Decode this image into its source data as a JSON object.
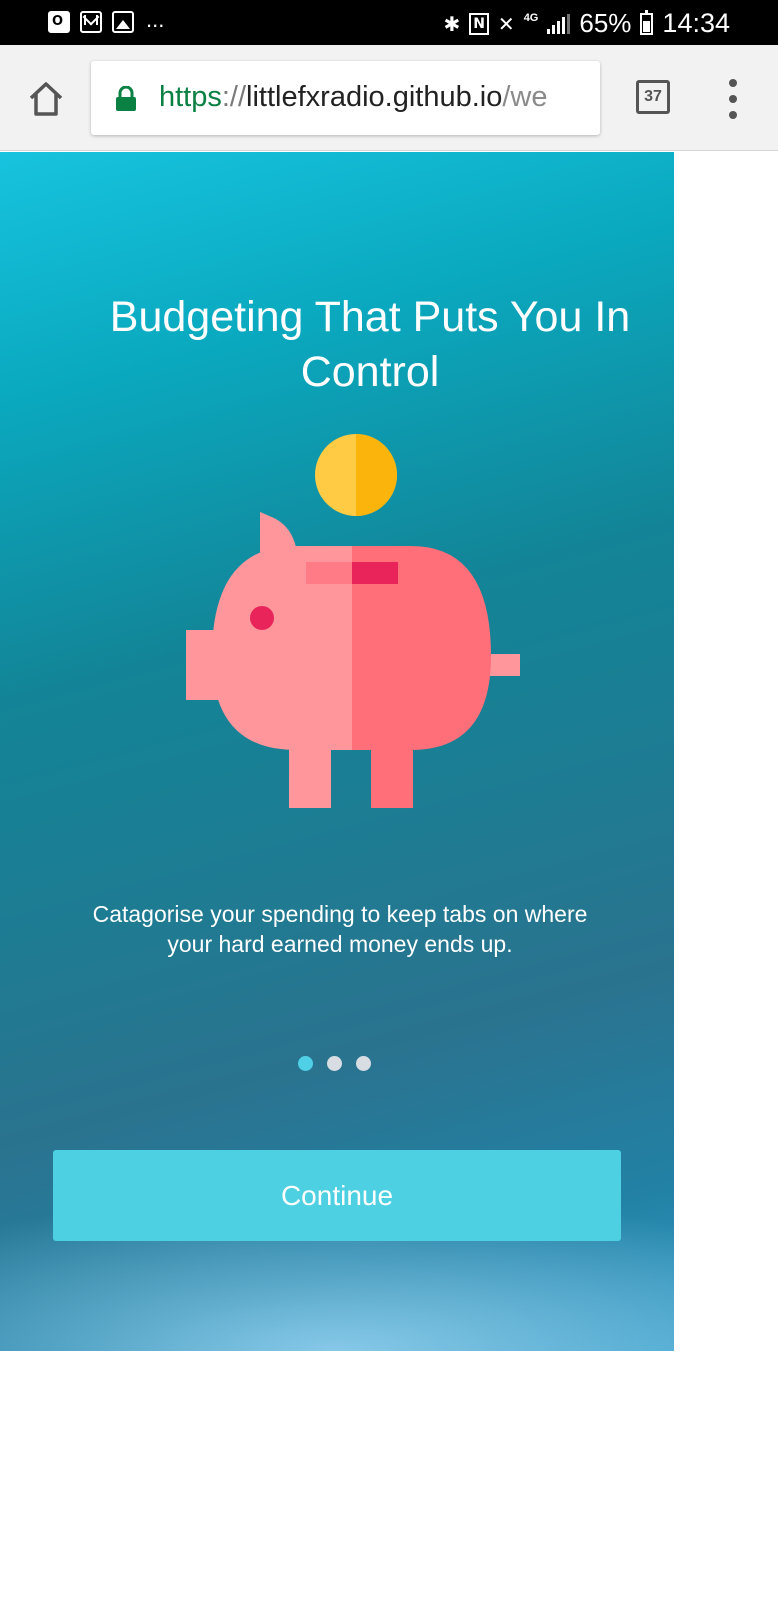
{
  "status_bar": {
    "notification_icons": [
      "outlook-icon",
      "gmail-icon",
      "image-icon"
    ],
    "more": "...",
    "network": "4G",
    "battery": "65%",
    "time": "14:34"
  },
  "browser": {
    "url_scheme": "https",
    "url_separator": "://",
    "url_host": "littlefxradio.github.io",
    "url_rest": "/we",
    "tab_count": "37",
    "secure_color": "#0b8043"
  },
  "onboarding": {
    "headline": "Budgeting That Puts You In Control",
    "description": "Catagorise your spending to keep tabs on where your hard earned money ends up.",
    "pages": {
      "count": 3,
      "active": 1
    },
    "continue_label": "Continue",
    "colors": {
      "accent": "#4dd0e2",
      "pig_light": "#ff969c",
      "pig_dark": "#ff6f79",
      "coin_light": "#ffcb44",
      "coin_dark": "#fbb40c"
    }
  }
}
